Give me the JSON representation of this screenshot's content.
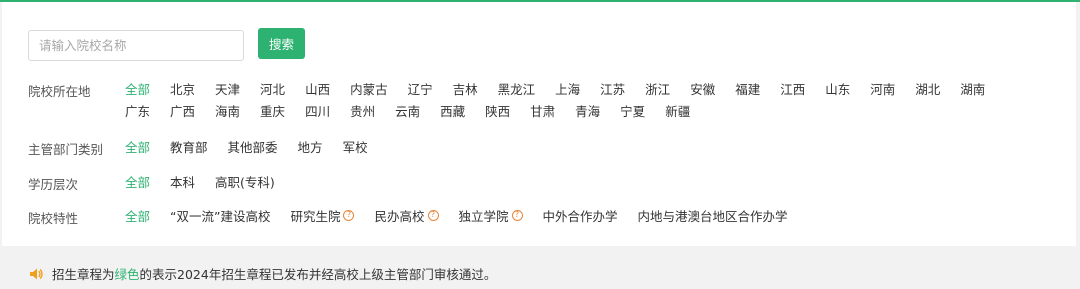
{
  "search": {
    "placeholder": "请输入院校名称",
    "button_label": "搜索"
  },
  "filters": {
    "location": {
      "label": "院校所在地",
      "line1": [
        "全部",
        "北京",
        "天津",
        "河北",
        "山西",
        "内蒙古",
        "辽宁",
        "吉林",
        "黑龙江",
        "上海",
        "江苏",
        "浙江",
        "安徽",
        "福建",
        "江西",
        "山东",
        "河南",
        "湖北",
        "湖南"
      ],
      "line2": [
        "广东",
        "广西",
        "海南",
        "重庆",
        "四川",
        "贵州",
        "云南",
        "西藏",
        "陕西",
        "甘肃",
        "青海",
        "宁夏",
        "新疆"
      ],
      "selected": "全部"
    },
    "authority": {
      "label": "主管部门类别",
      "options": [
        "全部",
        "教育部",
        "其他部委",
        "地方",
        "军校"
      ],
      "selected": "全部"
    },
    "level": {
      "label": "学历层次",
      "options": [
        "全部",
        "本科",
        "高职(专科)"
      ],
      "selected": "全部"
    },
    "feature": {
      "label": "院校特性",
      "options": [
        "全部",
        "“双一流”建设高校",
        "研究生院",
        "民办高校",
        "独立学院",
        "中外合作办学",
        "内地与港澳台地区合作办学"
      ],
      "help_options": [
        "研究生院",
        "民办高校",
        "独立学院"
      ],
      "selected": "全部"
    }
  },
  "notice": {
    "prefix": "招生章程为",
    "highlight": "绿色",
    "suffix": "的表示2024年招生章程已发布并经高校上级主管部门审核通过。",
    "icon": "speaker-icon"
  },
  "colors": {
    "accent": "#2eb272",
    "help": "#e8873a"
  }
}
